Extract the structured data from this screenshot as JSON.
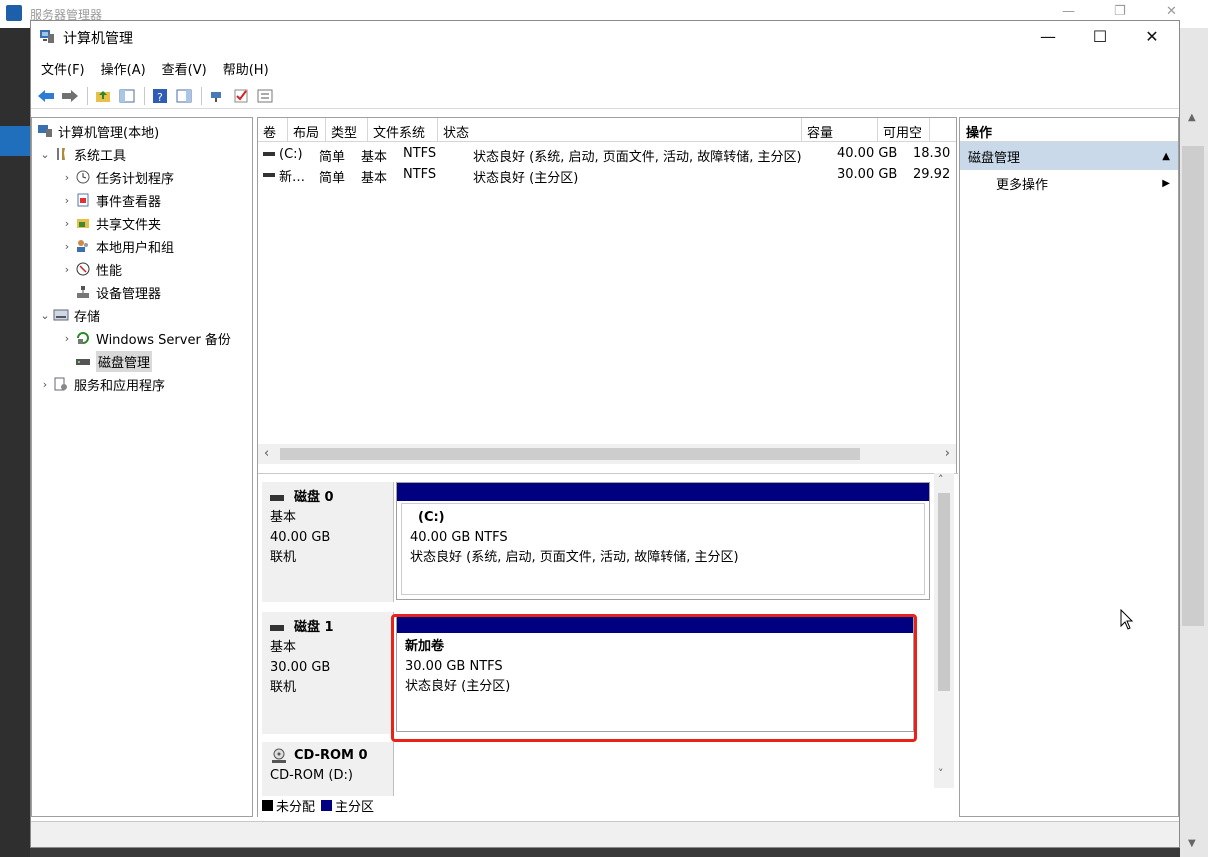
{
  "bg_window": {
    "title": "服务器管理器"
  },
  "window": {
    "title": "计算机管理",
    "controls": {
      "minimize": "—",
      "maximize": "☐",
      "close": "✕"
    }
  },
  "menu": [
    "文件(F)",
    "操作(A)",
    "查看(V)",
    "帮助(H)"
  ],
  "tree": {
    "root": "计算机管理(本地)",
    "system_tools": "系统工具",
    "task_scheduler": "任务计划程序",
    "event_viewer": "事件查看器",
    "shared_folders": "共享文件夹",
    "local_users": "本地用户和组",
    "performance": "性能",
    "device_manager": "设备管理器",
    "storage": "存储",
    "windows_backup": "Windows Server 备份",
    "disk_management": "磁盘管理",
    "services_apps": "服务和应用程序"
  },
  "volume_list": {
    "headers": [
      "卷",
      "布局",
      "类型",
      "文件系统",
      "状态",
      "容量",
      "可用空"
    ],
    "rows": [
      [
        "(C:)",
        "简单",
        "基本",
        "NTFS",
        "状态良好 (系统, 启动, 页面文件, 活动, 故障转储, 主分区)",
        "40.00 GB",
        "18.30"
      ],
      [
        "新…",
        "简单",
        "基本",
        "NTFS",
        "状态良好 (主分区)",
        "30.00 GB",
        "29.92"
      ]
    ]
  },
  "disks": [
    {
      "name": "磁盘 0",
      "type": "基本",
      "size": "40.00 GB",
      "status": "联机",
      "partition": {
        "name": "(C:)",
        "size_fs": "40.00 GB NTFS",
        "status": "状态良好 (系统, 启动, 页面文件, 活动, 故障转储, 主分区)"
      }
    },
    {
      "name": "磁盘 1",
      "type": "基本",
      "size": "30.00 GB",
      "status": "联机",
      "partition": {
        "name": "新加卷",
        "size_fs": "30.00 GB NTFS",
        "status": "状态良好 (主分区)"
      }
    },
    {
      "name": "CD-ROM 0",
      "type": "CD-ROM (D:)"
    }
  ],
  "legend": {
    "unallocated": "未分配",
    "primary": "主分区"
  },
  "actions": {
    "header": "操作",
    "group": "磁盘管理",
    "more": "更多操作"
  },
  "colors": {
    "partition_bar": "#000080",
    "highlight": "#e8231a",
    "action_group_bg": "#c9d9ea"
  }
}
